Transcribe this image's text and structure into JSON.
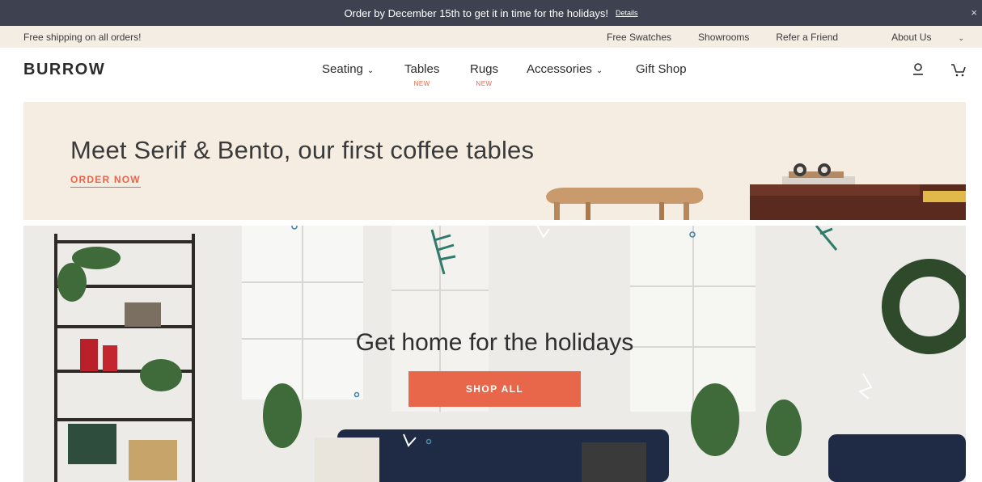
{
  "promo": {
    "text": "Order by December 15th to get it in time for the holidays!",
    "details": "Details",
    "close": "×"
  },
  "utility": {
    "shipping": "Free shipping on all orders!",
    "links": [
      "Free Swatches",
      "Showrooms",
      "Refer a Friend",
      "About Us"
    ]
  },
  "nav": {
    "logo": "BURROW",
    "items": [
      {
        "label": "Seating",
        "tag": ""
      },
      {
        "label": "Tables",
        "tag": "NEW"
      },
      {
        "label": "Rugs",
        "tag": "NEW"
      },
      {
        "label": "Accessories",
        "tag": ""
      },
      {
        "label": "Gift Shop",
        "tag": ""
      }
    ],
    "dropdown_glyph": "⌄"
  },
  "hero1": {
    "title": "Meet Serif & Bento, our first coffee tables",
    "cta": "ORDER NOW"
  },
  "hero2": {
    "title": "Get home for the holidays",
    "cta": "SHOP ALL"
  },
  "colors": {
    "promo_bg": "#3e4150",
    "accent": "#e8674a",
    "cream": "#f5ede2"
  },
  "icons": [
    "user-icon",
    "cart-icon",
    "close-icon",
    "chevron-down-icon"
  ]
}
